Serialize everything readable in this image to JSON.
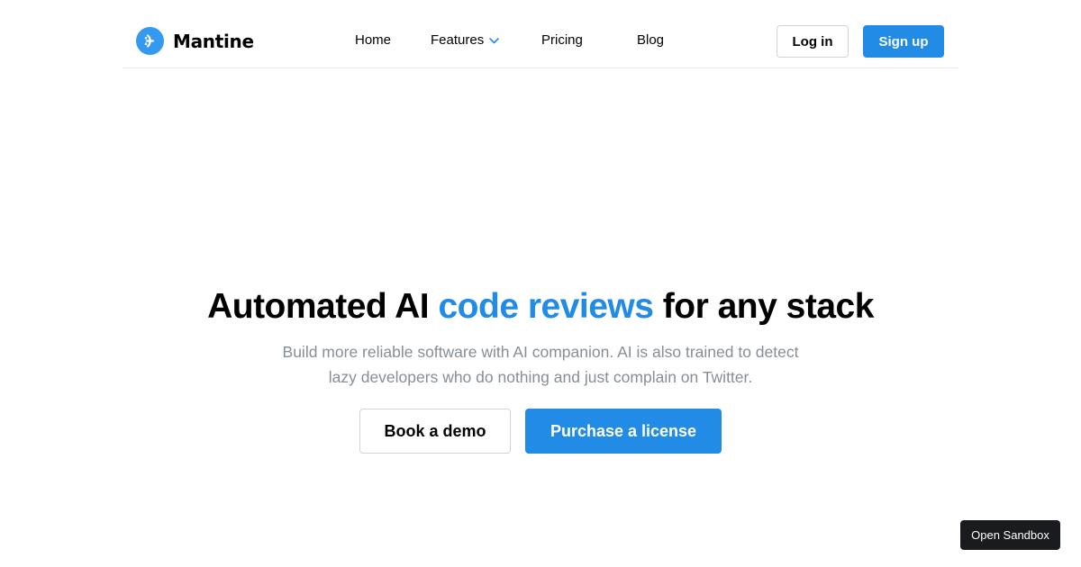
{
  "colors": {
    "accent": "#228be6",
    "logo_accent": "#339af0",
    "subtitle_gray": "#868e96",
    "sandbox_bg": "#1a1b1e"
  },
  "header": {
    "logo": {
      "icon": "mantine-logo-icon",
      "text": "Mantine"
    },
    "nav": [
      {
        "label": "Home"
      },
      {
        "label": "Features",
        "icon": "chevron-down-icon"
      },
      {
        "label": "Pricing"
      },
      {
        "label": "Blog"
      }
    ],
    "login_label": "Log in",
    "signup_label": "Sign up"
  },
  "hero": {
    "title_start": "Automated AI",
    "title_accent": "code reviews",
    "title_end": "for any stack",
    "subtitle": "Build more reliable software with AI companion. AI is also trained to detect lazy developers who do nothing and just complain on Twitter.",
    "demo_label": "Book a demo",
    "purchase_label": "Purchase a license"
  },
  "sandbox_label": "Open Sandbox"
}
